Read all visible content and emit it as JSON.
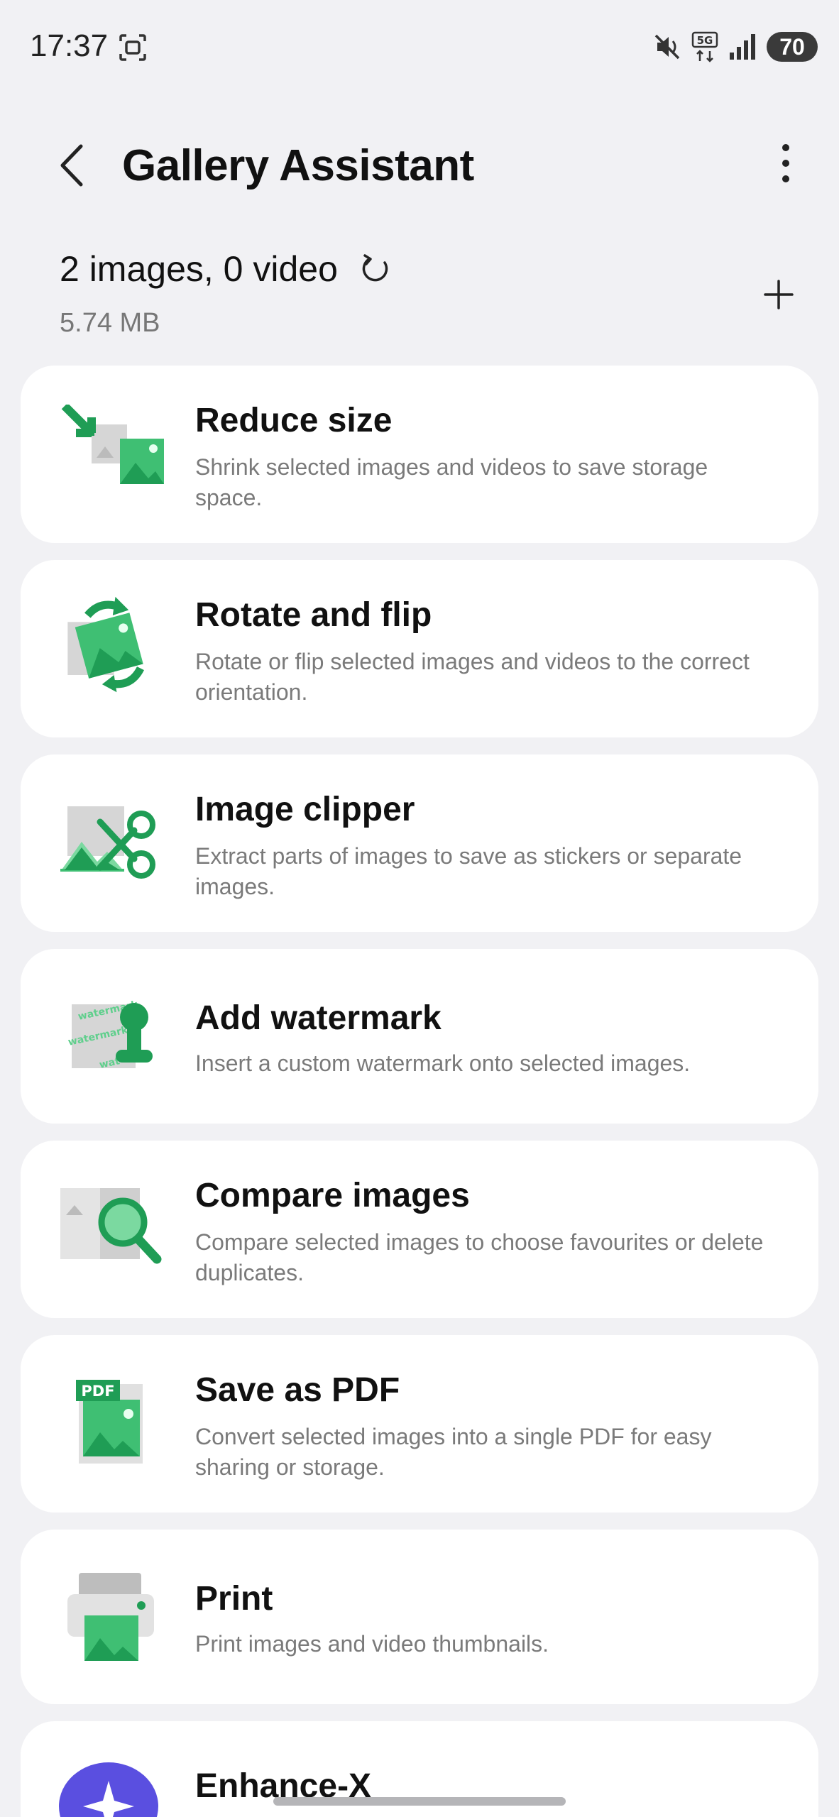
{
  "status_bar": {
    "time": "17:37",
    "battery": "70",
    "network": "5G"
  },
  "header": {
    "title": "Gallery Assistant"
  },
  "summary": {
    "count_label": "2 images, 0 video",
    "size_label": "5.74 MB"
  },
  "tools": [
    {
      "title": "Reduce size",
      "description": "Shrink selected images and videos to save storage space.",
      "icon": "reduce-size-icon"
    },
    {
      "title": "Rotate and flip",
      "description": "Rotate or flip selected images and videos to the correct orientation.",
      "icon": "rotate-flip-icon"
    },
    {
      "title": "Image clipper",
      "description": "Extract parts of images to save as stickers or separate images.",
      "icon": "image-clipper-icon"
    },
    {
      "title": "Add watermark",
      "description": "Insert a custom watermark onto selected images.",
      "icon": "watermark-icon",
      "icon_text": [
        "watermark",
        "watermark",
        "wat"
      ]
    },
    {
      "title": "Compare images",
      "description": "Compare selected images to choose favourites or delete duplicates.",
      "icon": "compare-icon"
    },
    {
      "title": "Save as PDF",
      "description": "Convert selected images into a single PDF for easy sharing or storage.",
      "icon": "pdf-icon",
      "icon_text": "PDF"
    },
    {
      "title": "Print",
      "description": "Print images and video thumbnails.",
      "icon": "print-icon"
    },
    {
      "title": "Enhance-X",
      "description": "",
      "icon": "enhance-x-icon"
    }
  ],
  "colors": {
    "accent_green": "#1f9d55",
    "light_green": "#5fcf8c",
    "background": "#f1f1f4",
    "card": "#ffffff",
    "enhance_purple": "#5a4fe0"
  }
}
